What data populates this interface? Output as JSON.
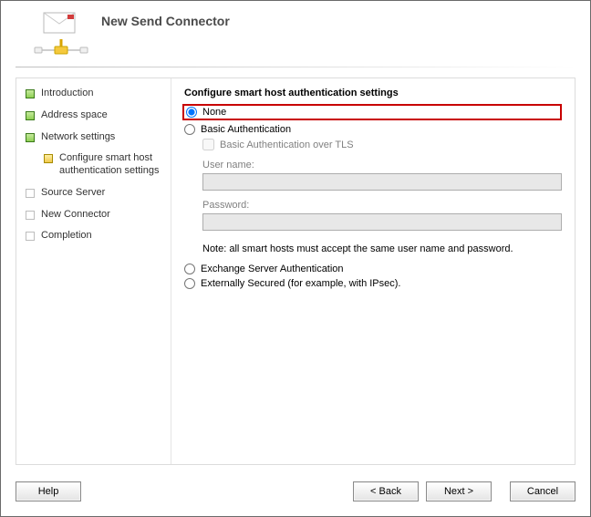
{
  "header": {
    "title": "New Send Connector"
  },
  "sidebar": {
    "items": [
      {
        "label": "Introduction",
        "state": "done"
      },
      {
        "label": "Address space",
        "state": "done"
      },
      {
        "label": "Network settings",
        "state": "done"
      },
      {
        "label": "Configure smart host authentication settings",
        "state": "current",
        "sub": true
      },
      {
        "label": "Source Server",
        "state": "pending"
      },
      {
        "label": "New Connector",
        "state": "pending"
      },
      {
        "label": "Completion",
        "state": "pending"
      }
    ]
  },
  "main": {
    "heading": "Configure smart host authentication settings",
    "options": {
      "none": "None",
      "basic": "Basic Authentication",
      "basic_tls": "Basic Authentication over TLS",
      "exchange": "Exchange Server Authentication",
      "external": "Externally Secured (for example, with IPsec).",
      "selected": "none"
    },
    "fields": {
      "username_label": "User name:",
      "username_value": "",
      "password_label": "Password:",
      "password_value": ""
    },
    "note": "Note: all smart hosts must accept the same user name and password."
  },
  "footer": {
    "help": "Help",
    "back": "< Back",
    "next": "Next >",
    "cancel": "Cancel"
  }
}
